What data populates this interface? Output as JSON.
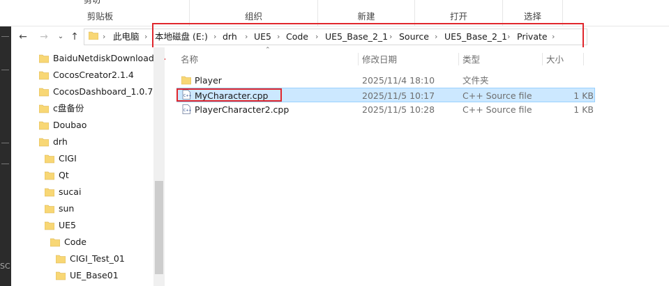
{
  "ribbon": {
    "groups": [
      {
        "label": "剪贴板",
        "clipped": "剪切"
      },
      {
        "label": "组织",
        "clipped": ""
      },
      {
        "label": "新建",
        "clipped": ""
      },
      {
        "label": "打开",
        "clipped": ""
      },
      {
        "label": "选择",
        "clipped": ""
      }
    ]
  },
  "address": {
    "crumbs": [
      "此电脑",
      "本地磁盘 (E:)",
      "drh",
      "UE5",
      "Code",
      "UE5_Base_2_1",
      "Source",
      "UE5_Base_2_1",
      "Private"
    ]
  },
  "tree": {
    "items": [
      {
        "label": "BaiduNetdiskDownload"
      },
      {
        "label": "CocosCreator2.1.4"
      },
      {
        "label": "CocosDashboard_1.0.7"
      },
      {
        "label": "c盘备份"
      },
      {
        "label": "Doubao"
      },
      {
        "label": "drh"
      },
      {
        "label": "CIGI"
      },
      {
        "label": "Qt"
      },
      {
        "label": "sucai"
      },
      {
        "label": "sun"
      },
      {
        "label": "UE5"
      },
      {
        "label": "Code"
      },
      {
        "label": "CIGI_Test_01"
      },
      {
        "label": "UE_Base01"
      }
    ]
  },
  "columns": {
    "name": "名称",
    "date": "修改日期",
    "type": "类型",
    "size": "大小"
  },
  "files": [
    {
      "name": "Player",
      "date": "2025/11/4 18:10",
      "type": "文件夹",
      "size": "",
      "icon": "folder-icon"
    },
    {
      "name": "MyCharacter.cpp",
      "date": "2025/11/5 10:17",
      "type": "C++ Source file",
      "size": "1 KB",
      "icon": "cpp-file-icon"
    },
    {
      "name": "PlayerCharacter2.cpp",
      "date": "2025/11/5 10:28",
      "type": "C++ Source file",
      "size": "1 KB",
      "icon": "cpp-file-icon"
    }
  ],
  "colors": {
    "highlight": "#e0262c",
    "selection": "#cce8ff",
    "folder": "#f8d775"
  }
}
